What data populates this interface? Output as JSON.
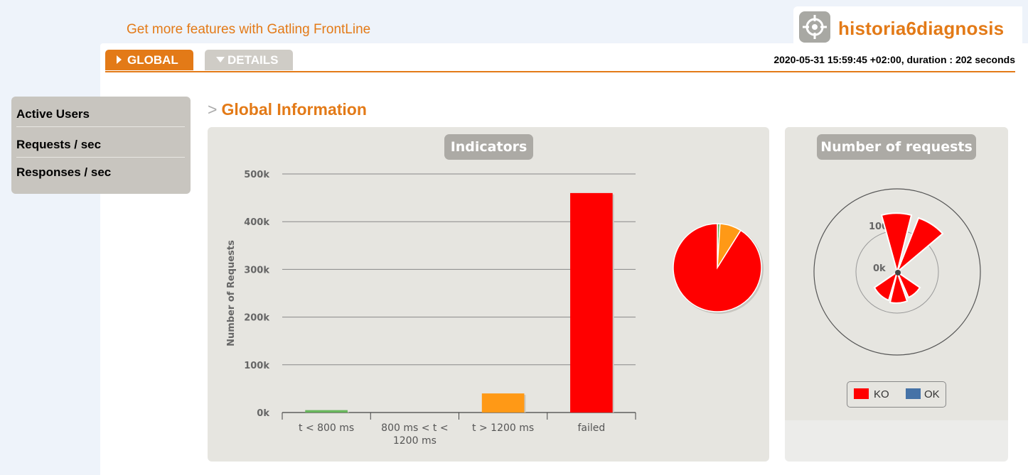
{
  "header": {
    "promo_link": "Get more features with Gatling FrontLine",
    "simulation_name": "historia6diagnosis",
    "run_info": "2020-05-31 15:59:45 +02:00, duration : 202 seconds"
  },
  "tabs": {
    "global": "GLOBAL",
    "details": "DETAILS"
  },
  "sidebar": {
    "items": [
      {
        "label": "Active Users"
      },
      {
        "label": "Requests / sec"
      },
      {
        "label": "Responses / sec"
      }
    ]
  },
  "section": {
    "title": "Global Information"
  },
  "indicators": {
    "title": "Indicators",
    "colors": {
      "ok_fast": "#68b65c",
      "ok_slow": "#ff9916",
      "failed": "#ff0000"
    }
  },
  "requests": {
    "title": "Number of requests",
    "legend": [
      {
        "label": "KO",
        "color": "#ff0000"
      },
      {
        "label": "OK",
        "color": "#4572a7"
      }
    ],
    "radial_labels": [
      "100k",
      "0k"
    ]
  },
  "chart_data": [
    {
      "type": "bar",
      "title": "Indicators",
      "ylabel": "Number of Requests",
      "categories": [
        "t < 800 ms",
        "800 ms < t < 1200 ms",
        "t > 1200 ms",
        "failed"
      ],
      "category_lines": [
        [
          "t < 800 ms"
        ],
        [
          "800 ms < t <",
          "1200 ms"
        ],
        [
          "t > 1200 ms"
        ],
        [
          "failed"
        ]
      ],
      "values": [
        5000,
        0,
        40000,
        460000
      ],
      "colors": [
        "#68b65c",
        "#ffff00",
        "#ff9916",
        "#ff0000"
      ],
      "ylim": [
        0,
        500000
      ],
      "yticks": [
        0,
        100000,
        200000,
        300000,
        400000,
        500000
      ],
      "ytick_labels": [
        "0k",
        "100k",
        "200k",
        "300k",
        "400k",
        "500k"
      ],
      "grid": true
    },
    {
      "type": "pie",
      "labels": [
        "t < 800 ms",
        "t > 1200 ms",
        "failed"
      ],
      "values": [
        5000,
        40000,
        460000
      ],
      "colors": [
        "#68b65c",
        "#ff9916",
        "#ff0000"
      ]
    }
  ]
}
